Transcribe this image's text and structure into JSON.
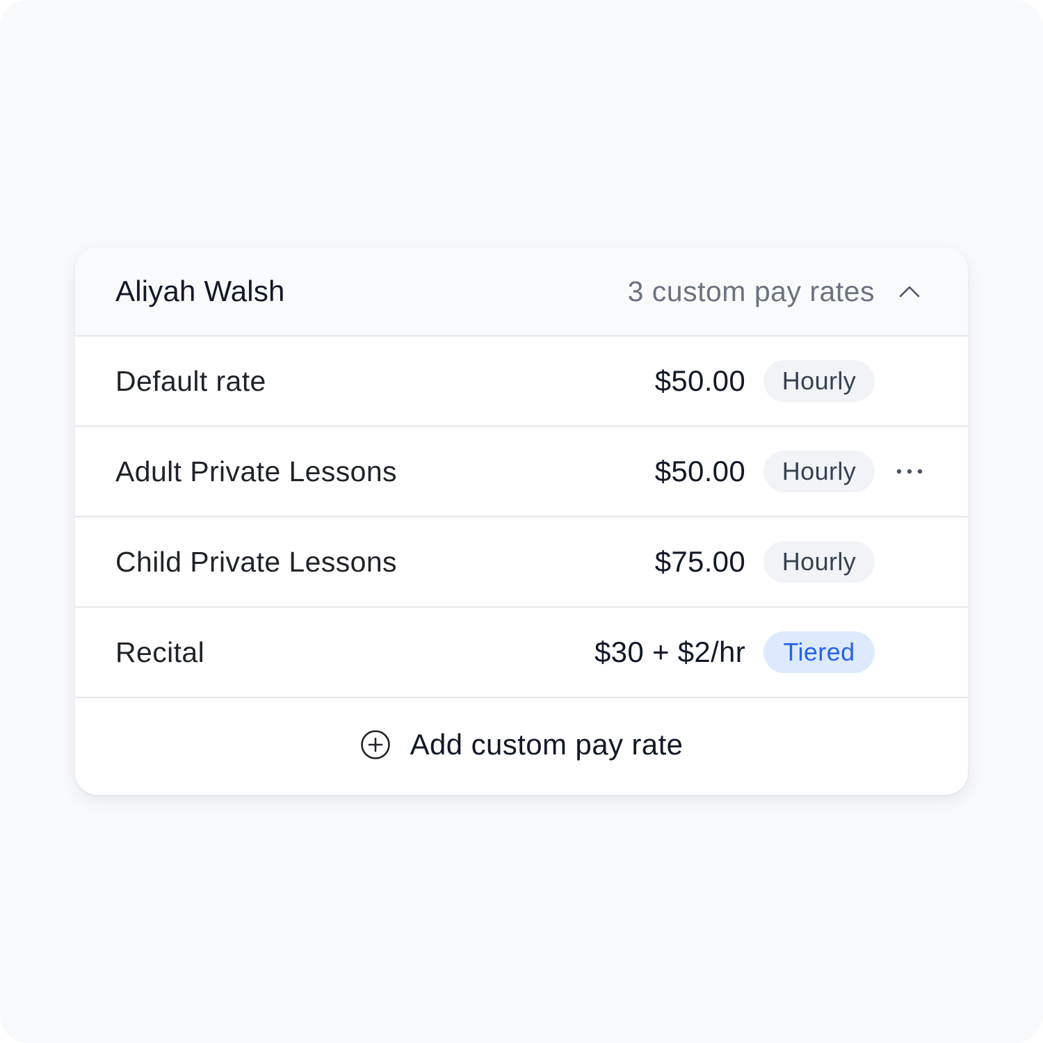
{
  "card": {
    "name": "Aliyah Walsh",
    "rate_count": "3 custom pay rates",
    "toggle_icon": "chevron-up-icon"
  },
  "rates": [
    {
      "label": "Default rate",
      "amount": "$50.00",
      "type": "Hourly",
      "has_menu": false
    },
    {
      "label": "Adult Private Lessons",
      "amount": "$50.00",
      "type": "Hourly",
      "has_menu": true
    },
    {
      "label": "Child Private Lessons",
      "amount": "$75.00",
      "type": "Hourly",
      "has_menu": false
    },
    {
      "label": "Recital",
      "amount": "$30 + $2/hr",
      "type": "Tiered",
      "has_menu": false
    }
  ],
  "add_button": {
    "label": "Add custom pay rate",
    "icon": "plus-circle-icon"
  },
  "colors": {
    "background": "#f8f9fb",
    "card": "#ffffff",
    "header": "#f9fafb",
    "divider": "#e6e8ec",
    "hourly_badge_bg": "#f1f3f6",
    "hourly_badge_text": "#374151",
    "tiered_badge_bg": "#ddeafe",
    "tiered_badge_text": "#2563eb"
  }
}
